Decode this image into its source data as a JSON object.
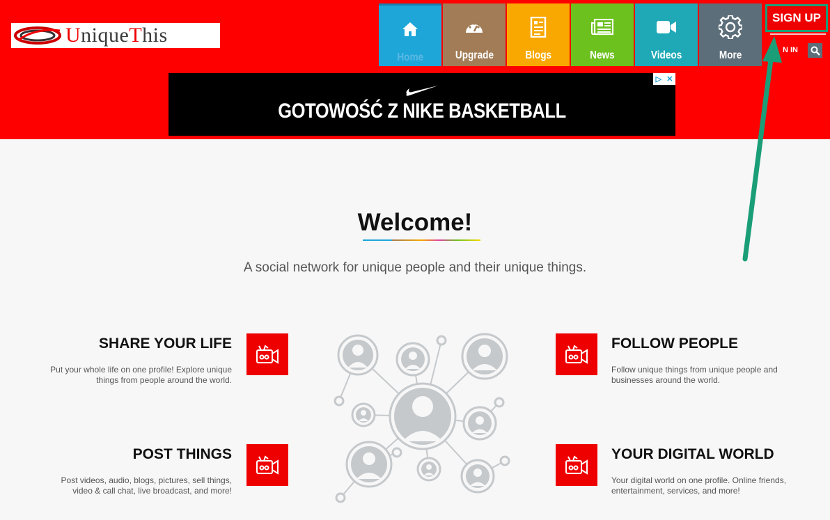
{
  "logo": {
    "text_first": "Unique",
    "text_second": "This",
    "cap1": "U",
    "rest1": "nique",
    "cap2": "T",
    "rest2": "his"
  },
  "nav": [
    {
      "key": "home",
      "label": "Home",
      "icon": "home-icon"
    },
    {
      "key": "upgrade",
      "label": "Upgrade",
      "icon": "speedometer-icon"
    },
    {
      "key": "blogs",
      "label": "Blogs",
      "icon": "document-icon"
    },
    {
      "key": "news",
      "label": "News",
      "icon": "newspaper-icon"
    },
    {
      "key": "videos",
      "label": "Videos",
      "icon": "video-camera-icon"
    },
    {
      "key": "more",
      "label": "More",
      "icon": "gear-icon"
    }
  ],
  "auth": {
    "signup_label": "SIGN UP",
    "signin_label": "N IN"
  },
  "ad": {
    "text": "GOTOWOŚĆ Z NIKE BASKETBALL"
  },
  "hero": {
    "title": "Welcome!",
    "tagline": "A social network for unique people and their unique things."
  },
  "features": {
    "share": {
      "title": "SHARE YOUR LIFE",
      "desc": "Put your whole life on one profile! Explore unique things from people around the world."
    },
    "follow": {
      "title": "FOLLOW PEOPLE",
      "desc": "Follow unique things from unique people and businesses around the world."
    },
    "post": {
      "title": "POST THINGS",
      "desc": "Post videos, audio, blogs, pictures, sell things, video & call chat, live broadcast, and more!"
    },
    "digital": {
      "title": "YOUR DIGITAL WORLD",
      "desc": "Your digital world on one profile. Online friends, entertainment, services, and more!"
    }
  },
  "colors": {
    "header": "#ff0000",
    "home": "#1ea6d9",
    "upgrade": "#a17c56",
    "blogs": "#f8a800",
    "news": "#6cc11f",
    "videos": "#1fa9b6",
    "more": "#5c6e79",
    "annotation_arrow": "#1a9e78"
  },
  "annotation": {
    "arrow": "green-arrow-pointing-to-sign-up"
  }
}
